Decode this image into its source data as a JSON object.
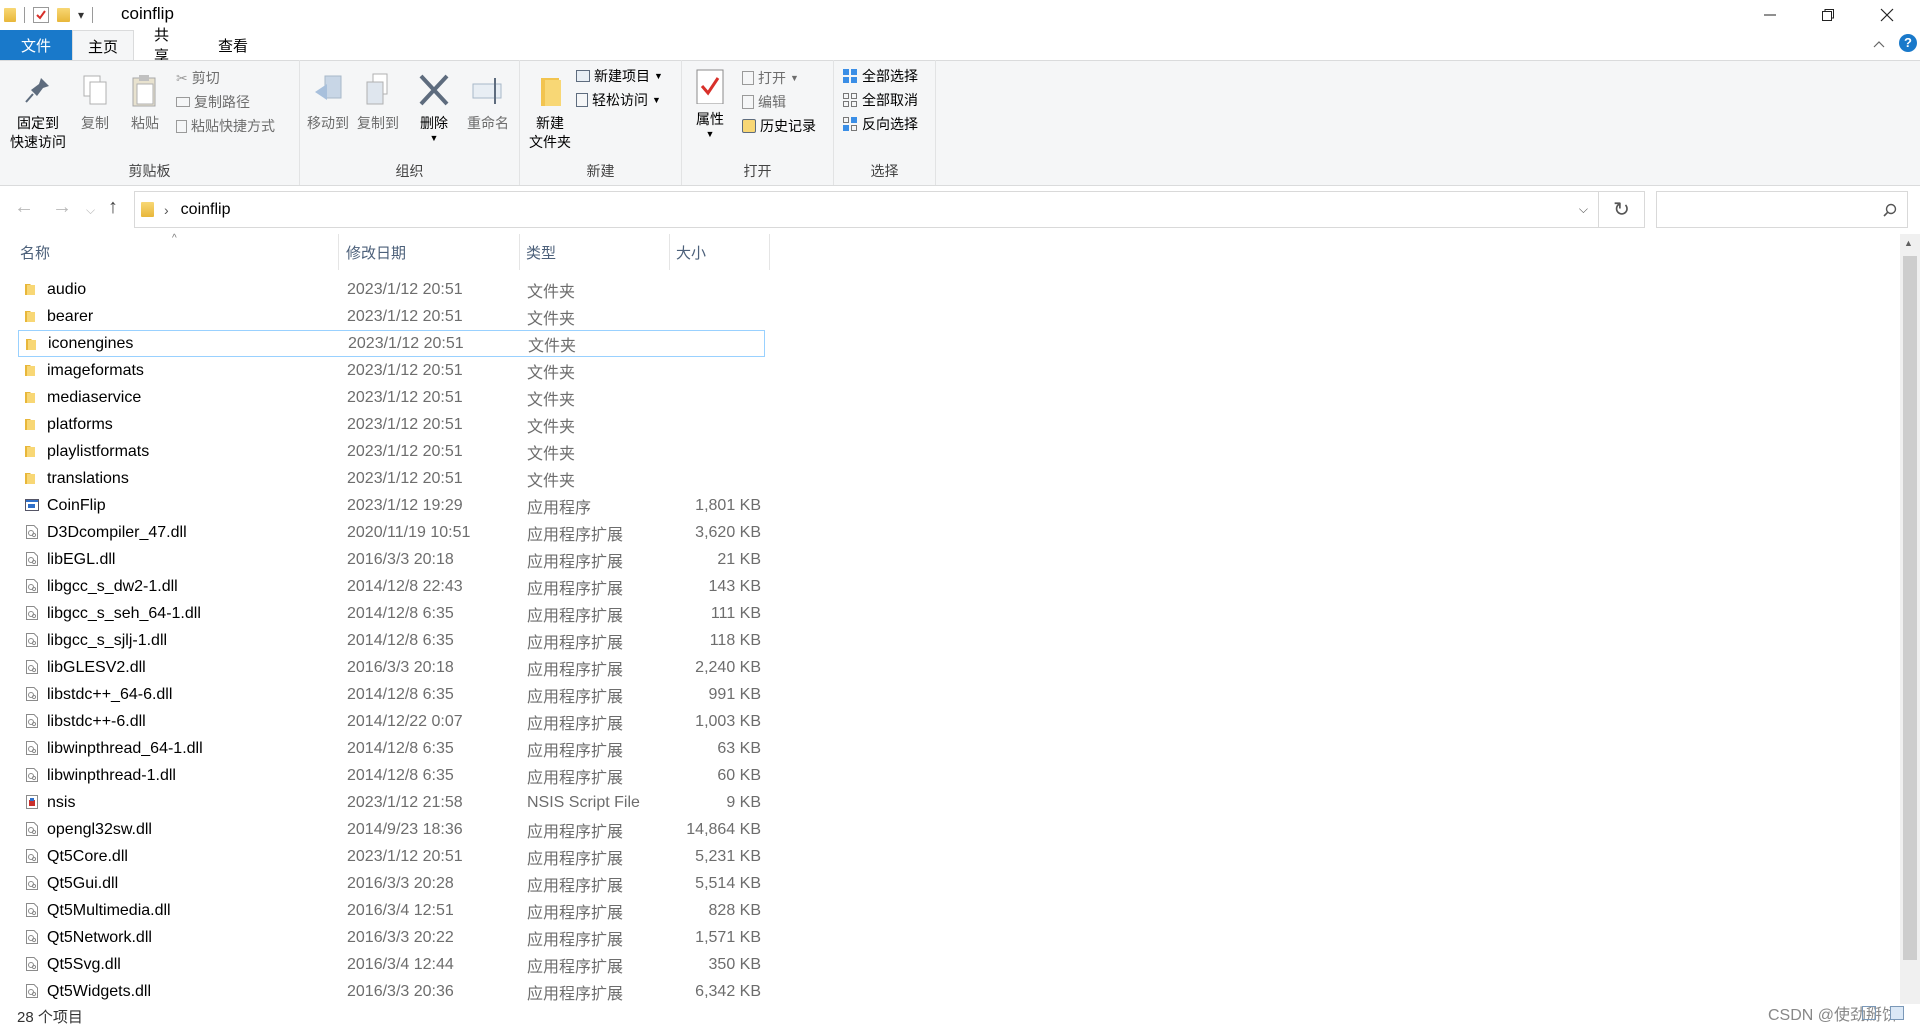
{
  "window": {
    "title": "coinflip",
    "qat_dropdown": "▾"
  },
  "tabs": [
    "文件",
    "主页",
    "共享",
    "查看"
  ],
  "ribbon": {
    "clipboard": {
      "label": "剪贴板",
      "pin_line1": "固定到",
      "pin_line2": "快速访问",
      "copy": "复制",
      "paste": "粘贴",
      "cut": "剪切",
      "copy_path": "复制路径",
      "paste_shortcut": "粘贴快捷方式"
    },
    "organize": {
      "label": "组织",
      "move_to": "移动到",
      "copy_to": "复制到",
      "delete": "删除",
      "rename": "重命名"
    },
    "new": {
      "label": "新建",
      "new_folder_line1": "新建",
      "new_folder_line2": "文件夹",
      "new_item": "新建项目",
      "easy_access": "轻松访问"
    },
    "open": {
      "label": "打开",
      "properties": "属性",
      "open": "打开",
      "edit": "编辑",
      "history": "历史记录"
    },
    "select": {
      "label": "选择",
      "select_all": "全部选择",
      "select_none": "全部取消",
      "invert": "反向选择"
    }
  },
  "address": {
    "path": "coinflip",
    "search_placeholder": ""
  },
  "columns": {
    "name": "名称",
    "date": "修改日期",
    "type": "类型",
    "size": "大小"
  },
  "files": [
    {
      "name": "audio",
      "date": "2023/1/12 20:51",
      "type": "文件夹",
      "size": "",
      "kind": "folder"
    },
    {
      "name": "bearer",
      "date": "2023/1/12 20:51",
      "type": "文件夹",
      "size": "",
      "kind": "folder"
    },
    {
      "name": "iconengines",
      "date": "2023/1/12 20:51",
      "type": "文件夹",
      "size": "",
      "kind": "folder"
    },
    {
      "name": "imageformats",
      "date": "2023/1/12 20:51",
      "type": "文件夹",
      "size": "",
      "kind": "folder"
    },
    {
      "name": "mediaservice",
      "date": "2023/1/12 20:51",
      "type": "文件夹",
      "size": "",
      "kind": "folder"
    },
    {
      "name": "platforms",
      "date": "2023/1/12 20:51",
      "type": "文件夹",
      "size": "",
      "kind": "folder"
    },
    {
      "name": "playlistformats",
      "date": "2023/1/12 20:51",
      "type": "文件夹",
      "size": "",
      "kind": "folder"
    },
    {
      "name": "translations",
      "date": "2023/1/12 20:51",
      "type": "文件夹",
      "size": "",
      "kind": "folder"
    },
    {
      "name": "CoinFlip",
      "date": "2023/1/12 19:29",
      "type": "应用程序",
      "size": "1,801 KB",
      "kind": "app"
    },
    {
      "name": "D3Dcompiler_47.dll",
      "date": "2020/11/19 10:51",
      "type": "应用程序扩展",
      "size": "3,620 KB",
      "kind": "dll"
    },
    {
      "name": "libEGL.dll",
      "date": "2016/3/3 20:18",
      "type": "应用程序扩展",
      "size": "21 KB",
      "kind": "dll"
    },
    {
      "name": "libgcc_s_dw2-1.dll",
      "date": "2014/12/8 22:43",
      "type": "应用程序扩展",
      "size": "143 KB",
      "kind": "dll"
    },
    {
      "name": "libgcc_s_seh_64-1.dll",
      "date": "2014/12/8 6:35",
      "type": "应用程序扩展",
      "size": "111 KB",
      "kind": "dll"
    },
    {
      "name": "libgcc_s_sjlj-1.dll",
      "date": "2014/12/8 6:35",
      "type": "应用程序扩展",
      "size": "118 KB",
      "kind": "dll"
    },
    {
      "name": "libGLESV2.dll",
      "date": "2016/3/3 20:18",
      "type": "应用程序扩展",
      "size": "2,240 KB",
      "kind": "dll"
    },
    {
      "name": "libstdc++_64-6.dll",
      "date": "2014/12/8 6:35",
      "type": "应用程序扩展",
      "size": "991 KB",
      "kind": "dll"
    },
    {
      "name": "libstdc++-6.dll",
      "date": "2014/12/22 0:07",
      "type": "应用程序扩展",
      "size": "1,003 KB",
      "kind": "dll"
    },
    {
      "name": "libwinpthread_64-1.dll",
      "date": "2014/12/8 6:35",
      "type": "应用程序扩展",
      "size": "63 KB",
      "kind": "dll"
    },
    {
      "name": "libwinpthread-1.dll",
      "date": "2014/12/8 6:35",
      "type": "应用程序扩展",
      "size": "60 KB",
      "kind": "dll"
    },
    {
      "name": "nsis",
      "date": "2023/1/12 21:58",
      "type": "NSIS Script File",
      "size": "9 KB",
      "kind": "script"
    },
    {
      "name": "opengl32sw.dll",
      "date": "2014/9/23 18:36",
      "type": "应用程序扩展",
      "size": "14,864 KB",
      "kind": "dll"
    },
    {
      "name": "Qt5Core.dll",
      "date": "2023/1/12 20:51",
      "type": "应用程序扩展",
      "size": "5,231 KB",
      "kind": "dll"
    },
    {
      "name": "Qt5Gui.dll",
      "date": "2016/3/3 20:28",
      "type": "应用程序扩展",
      "size": "5,514 KB",
      "kind": "dll"
    },
    {
      "name": "Qt5Multimedia.dll",
      "date": "2016/3/4 12:51",
      "type": "应用程序扩展",
      "size": "828 KB",
      "kind": "dll"
    },
    {
      "name": "Qt5Network.dll",
      "date": "2016/3/3 20:22",
      "type": "应用程序扩展",
      "size": "1,571 KB",
      "kind": "dll"
    },
    {
      "name": "Qt5Svg.dll",
      "date": "2016/3/4 12:44",
      "type": "应用程序扩展",
      "size": "350 KB",
      "kind": "dll"
    },
    {
      "name": "Qt5Widgets.dll",
      "date": "2016/3/3 20:36",
      "type": "应用程序扩展",
      "size": "6,342 KB",
      "kind": "dll"
    }
  ],
  "selected_row": 2,
  "status": {
    "count": "28 个项目"
  },
  "watermark": "CSDN @使劲掰饼",
  "colors": {
    "accent": "#1979ca",
    "selection_border": "#99d1ff",
    "header_text": "#4c607a"
  }
}
